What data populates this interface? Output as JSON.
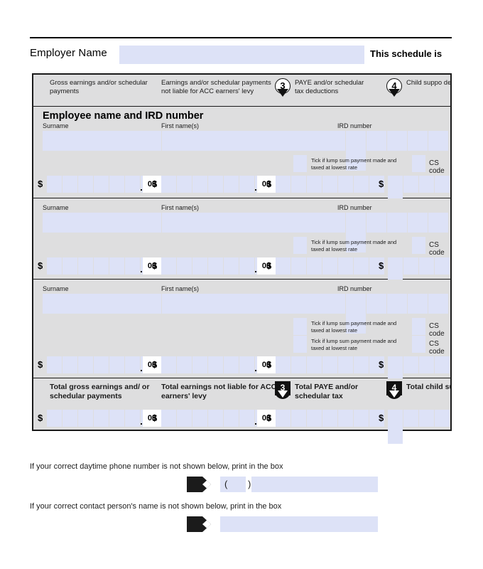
{
  "header": {
    "employer_name_label": "Employer Name",
    "employer_name_value": "",
    "schedule_is_label": "This schedule is"
  },
  "column_headers": {
    "col1": "Gross earnings and/or schedular payments",
    "col2": "Earnings and/or schedular payments not liable for ACC earners' levy",
    "col3_marker": "3",
    "col3": "PAYE and/or schedular tax deductions",
    "col4_marker": "4",
    "col4": "Child suppo deductions"
  },
  "employee_section": {
    "title": "Employee name and IRD number",
    "surname_label": "Surname",
    "first_names_label": "First name(s)",
    "ird_label": "IRD number",
    "tick_label": "Tick if lump sum payment made and taxed at lowest rate",
    "cs_code_label": "CS code",
    "dollar_sign": "$",
    "cents": "00",
    "ird_cells": 6,
    "money_cells": 6,
    "paye_cells": 7,
    "cs_cells": 5
  },
  "rows": [
    {
      "surname": "",
      "first_names": "",
      "ird_number": "",
      "tick_rows": 1,
      "gross": "",
      "not_liable": "",
      "paye": "",
      "child_support": ""
    },
    {
      "surname": "",
      "first_names": "",
      "ird_number": "",
      "tick_rows": 1,
      "gross": "",
      "not_liable": "",
      "paye": "",
      "child_support": ""
    },
    {
      "surname": "",
      "first_names": "",
      "ird_number": "",
      "tick_rows": 2,
      "gross": "",
      "not_liable": "",
      "paye": "",
      "child_support": ""
    }
  ],
  "totals": {
    "col1": "Total gross earnings and/ or schedular payments",
    "col2": "Total earnings not liable for ACC earners' levy",
    "col3_marker": "3",
    "col3": "Total PAYE and/or schedular tax",
    "col4_marker": "4",
    "col4": "Total child supp",
    "dollar_sign": "$",
    "cents": "00"
  },
  "footer": {
    "phone_line": "If your correct daytime phone number is not shown below, print in the box",
    "contact_line": "If your correct contact person's name is not shown below, print in the box",
    "paren_open": "(",
    "paren_close": ")",
    "phone_value": "",
    "contact_value": ""
  },
  "colors": {
    "field_fill": "#dde2f7",
    "panel_bg": "#dededf",
    "border": "#1a1a1a",
    "page_bg": "#ffffff"
  }
}
